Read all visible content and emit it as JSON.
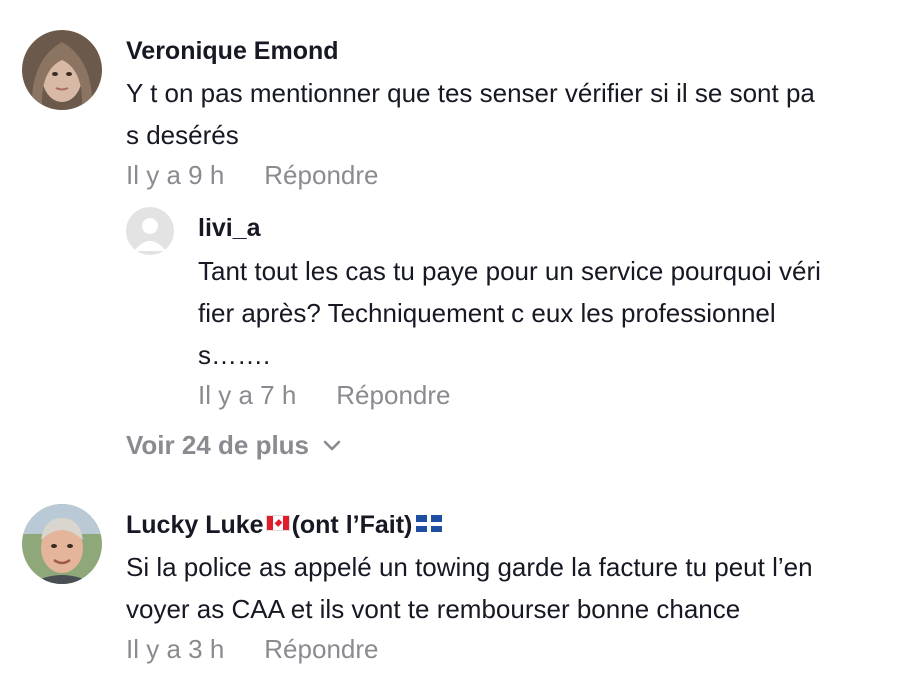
{
  "comments": [
    {
      "author": "Veronique Emond",
      "lines": [
        "Y t on pas mentionner que tes senser vérifier si il se sont pa",
        "s deséré s"
      ],
      "time": "Il y a 9 h",
      "reply": "Répondre"
    },
    {
      "author": "livi_a",
      "lines": [
        "Tant tout les cas tu paye pour un service pourquoi véri",
        "fier après? Techniquement c eux les professionnel",
        "s……."
      ],
      "time": "Il y a 7 h",
      "reply": "Répondre"
    },
    {
      "author_parts": [
        "Lucky  Luke",
        "(ont l’Fait)"
      ],
      "lines": [
        "Si la police as appelé un towing garde la facture tu peut l’en",
        "voyer as CAA et ils vont te rembourser bonne chance"
      ],
      "time": "Il y a 3 h",
      "reply": "Répondre"
    }
  ],
  "view_more": "Voir 24 de plus",
  "icons": [
    "chevron-down-icon",
    "canada-flag-icon",
    "quebec-flag-icon",
    "default-avatar-icon"
  ]
}
